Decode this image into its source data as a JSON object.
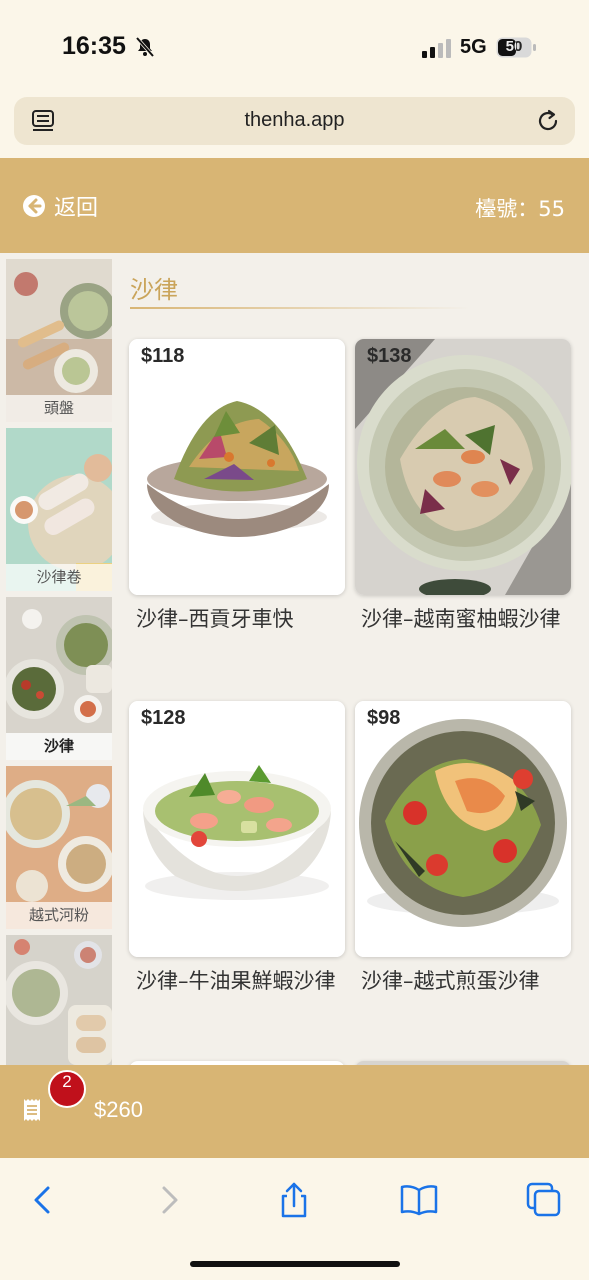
{
  "status": {
    "time": "16:35",
    "network": "5G",
    "battery": "50"
  },
  "browser": {
    "url": "thenha.app"
  },
  "header": {
    "back_label": "返回",
    "table_label": "檯號：55"
  },
  "categories": [
    {
      "label": "頭盤",
      "active": false
    },
    {
      "label": "沙律卷",
      "active": false
    },
    {
      "label": "沙律",
      "active": true
    },
    {
      "label": "越式河粉",
      "active": false
    },
    {
      "label": "",
      "active": false
    }
  ],
  "section": {
    "title": "沙律"
  },
  "items": [
    {
      "price": "$118",
      "name": "沙律–西貢牙車快"
    },
    {
      "price": "$138",
      "name": "沙律–越南蜜柚蝦沙律"
    },
    {
      "price": "$128",
      "name": "沙律–牛油果鮮蝦沙律"
    },
    {
      "price": "$98",
      "name": "沙律–越式煎蛋沙律"
    }
  ],
  "cart": {
    "count": "2",
    "total": "$260"
  },
  "colors": {
    "accent": "#d8b574",
    "badge": "#c0101b",
    "title": "#caa45a",
    "ios_blue": "#1a73e8"
  },
  "icons": [
    "bell-slash-icon",
    "signal-icon",
    "battery-icon",
    "reader-icon",
    "reload-icon",
    "back-arrow-icon",
    "receipt-icon",
    "nav-back-icon",
    "nav-forward-icon",
    "share-icon",
    "bookmarks-icon",
    "tabs-icon"
  ]
}
